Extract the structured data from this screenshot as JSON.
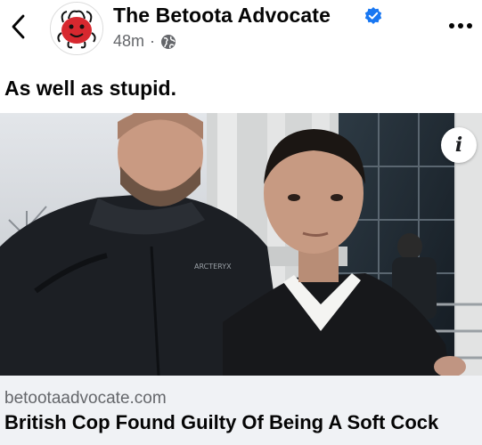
{
  "post": {
    "page_name": "The Betoota Advocate",
    "time": "48m",
    "separator": "·",
    "caption": "As well as stupid."
  },
  "link": {
    "domain": "betootaadvocate.com",
    "title": "British Cop Found Guilty Of Being A Soft Cock"
  },
  "icons": {
    "back": "chevron-left-icon",
    "verified": "verified-badge-icon",
    "audience": "globe-icon",
    "more": "more-dots-icon",
    "info": "info-icon"
  },
  "colors": {
    "verified_blue": "#1877f2",
    "meta_gray": "#65676b",
    "link_card_bg": "#f0f2f5",
    "avatar_red": "#d7282f"
  },
  "info_glyph": "i"
}
